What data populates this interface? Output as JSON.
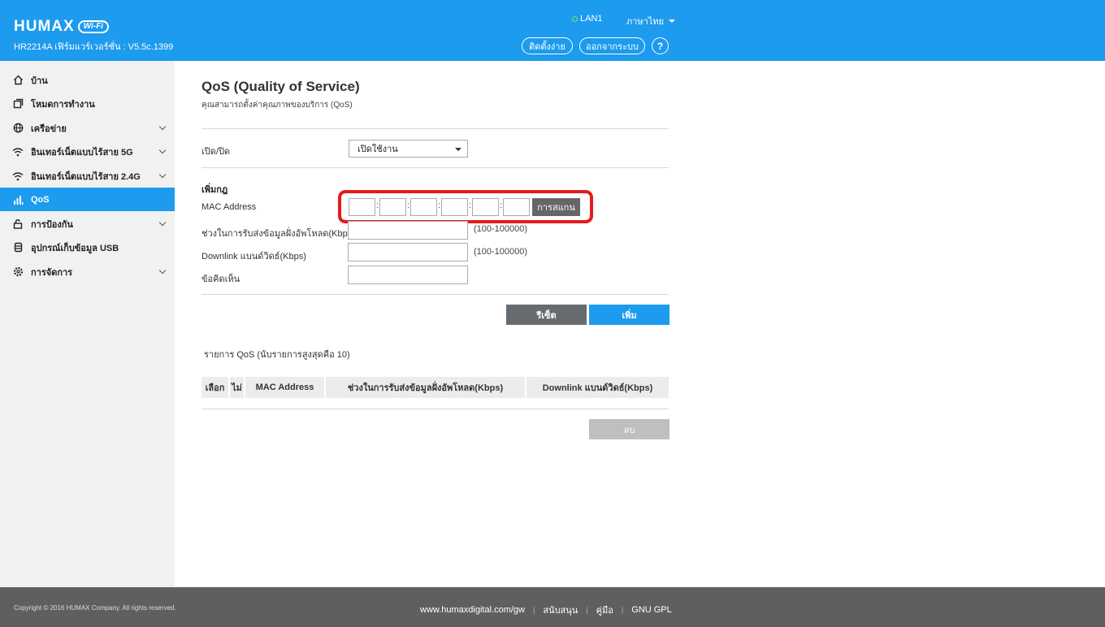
{
  "header": {
    "brand": "HUMAX",
    "brand_badge": "Wi-Fi",
    "firmware": "HR2214A เฟิร์มแวร์เวอร์ชั่น : V5.5c.1399",
    "lan_status": "LAN1",
    "language": "ภาษาไทย",
    "setup_button": "ติดตั้งง่าย",
    "logout_button": "ออกจากระบบ",
    "help_button": "?",
    "status_color": "#7be36a"
  },
  "sidebar": {
    "items": [
      {
        "label": "บ้าน",
        "icon": "home-icon"
      },
      {
        "label": "โหมดการทำงาน",
        "icon": "mode-icon"
      },
      {
        "label": "เครือข่าย",
        "icon": "globe-icon"
      },
      {
        "label": "อินเทอร์เน็ตแบบไร้สาย 5G",
        "icon": "wifi-icon"
      },
      {
        "label": "อินเทอร์เน็ตแบบไร้สาย 2.4G",
        "icon": "wifi-icon"
      },
      {
        "label": "QoS",
        "icon": "bar-chart-icon"
      },
      {
        "label": "การป้องกัน",
        "icon": "lock-icon"
      },
      {
        "label": "อุปกรณ์เก็บข้อมูล USB",
        "icon": "usb-storage-icon"
      },
      {
        "label": "การจัดการ",
        "icon": "gear-icon"
      }
    ],
    "active": "QoS"
  },
  "main": {
    "title": "QoS (Quality of Service)",
    "subtitle": "คุณสามารถตั้งค่าคุณภาพของบริการ (QoS)",
    "toggle_label": "เปิด/ปิด",
    "toggle_value": "เปิดใช้งาน",
    "add_rule_heading": "เพิ่มกฎ",
    "mac_label": "MAC Address",
    "scan_button": "การสแกน",
    "uplink_label": "ช่วงในการรับส่งข้อมูลฝั่งอัพโหลด(Kbps)",
    "uplink_range": "(100-100000)",
    "downlink_label": "Downlink แบนด์วิดธ์(Kbps)",
    "downlink_range": "(100-100000)",
    "comment_label": "ข้อคิดเห็น",
    "reset_button": "รีเซ็ต",
    "add_button": "เพิ่ม",
    "list_label": "รายการ QoS  (นับรายการสูงสุดคือ 10)",
    "table_headers": [
      "เลือก",
      "ไม่",
      "MAC Address",
      "ช่วงในการรับส่งข้อมูลฝั่งอัพโหลด(Kbps)",
      "Downlink แบนด์วิดธ์(Kbps)"
    ],
    "delete_button": "ลบ",
    "accent_color": "#1d9bee",
    "highlight_color": "#e51b1b"
  },
  "footer": {
    "copyright": "Copyright © 2016 HUMAX Company. All rights reserved.",
    "links": [
      "www.humaxdigital.com/gw",
      "สนับสนุน",
      "คู่มือ",
      "GNU GPL"
    ]
  }
}
